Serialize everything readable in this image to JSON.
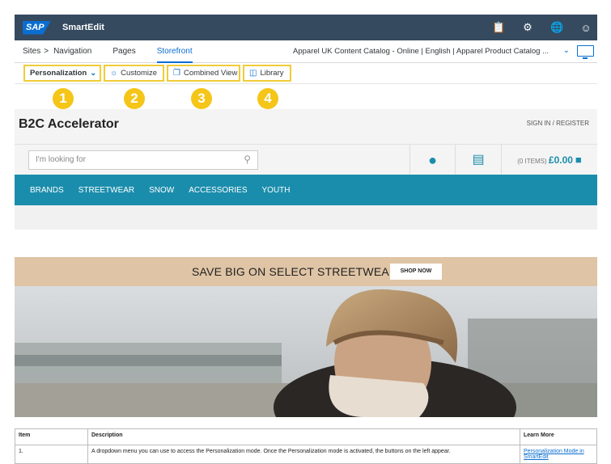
{
  "shell": {
    "logo": "SAP",
    "title": "SmartEdit",
    "icons": [
      "clipboard-icon",
      "gear-icon",
      "globe-icon",
      "user-icon"
    ]
  },
  "nav": {
    "sites": "Sites",
    "sites_separator": ">",
    "navigation": "Navigation",
    "pages": "Pages",
    "storefront": "Storefront",
    "catalog": "Apparel UK Content Catalog - Online | English | Apparel Product Catalog ..."
  },
  "toolbar": {
    "personalization": "Personalization",
    "customize": "Customize",
    "combined_view": "Combined View",
    "library": "Library"
  },
  "callouts": [
    "1",
    "2",
    "3",
    "4"
  ],
  "storefront": {
    "brand": "B2C Accelerator",
    "signin": "SIGN IN / REGISTER",
    "search_placeholder": "I'm looking for",
    "cart_items": "(0 ITEMS)",
    "cart_total": "£0.00",
    "menu": [
      "BRANDS",
      "STREETWEAR",
      "SNOW",
      "ACCESSORIES",
      "YOUTH"
    ],
    "banner_text": "SAVE BIG ON SELECT STREETWEAR",
    "shop_now": "SHOP NOW"
  },
  "table": {
    "headers": [
      "Item",
      "Description",
      "Learn More"
    ],
    "rows": [
      {
        "item": "1.",
        "description": "A dropdown menu you can use to access the Personalization mode. Once the Personalization mode is activated, the buttons on the left appear.",
        "link": "Personalization Mode in SmartEdit"
      }
    ]
  },
  "colors": {
    "shell": "#354a5f",
    "accent": "#0a6ed1",
    "teal": "#1b8dac",
    "callout": "#f5c518",
    "banner": "#dfc4a5"
  }
}
